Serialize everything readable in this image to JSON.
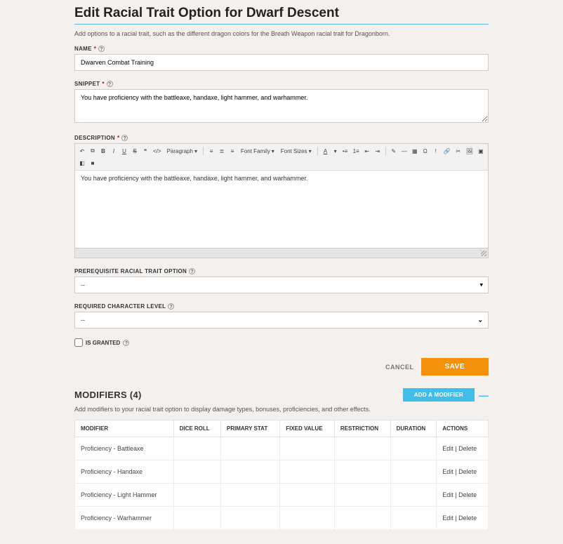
{
  "page": {
    "title": "Edit Racial Trait Option for Dwarf Descent",
    "subtitle": "Add options to a racial trait, such as the different dragon colors for the Breath Weapon racial trait for Dragonborn."
  },
  "fields": {
    "name": {
      "label": "NAME",
      "value": "Dwarven Combat Training"
    },
    "snippet": {
      "label": "SNIPPET",
      "value": "You have proficiency with the battleaxe, handaxe, light hammer, and warhammer."
    },
    "description": {
      "label": "DESCRIPTION",
      "value": "You have proficiency with the battleaxe, handaxe, light hammer, and warhammer.",
      "toolbar": {
        "paragraph": "Paragraph",
        "fontfamily": "Font Family",
        "fontsize": "Font Sizes"
      }
    },
    "prereq": {
      "label": "PREREQUISITE RACIAL TRAIT OPTION",
      "value": "--"
    },
    "reqlevel": {
      "label": "REQUIRED CHARACTER LEVEL",
      "value": "--"
    },
    "granted": {
      "label": "IS GRANTED"
    }
  },
  "actions": {
    "cancel": "CANCEL",
    "save": "SAVE"
  },
  "modifiers": {
    "title": "MODIFIERS (4)",
    "add_label": "ADD A MODIFIER",
    "desc": "Add modifiers to your racial trait option to display damage types, bonuses, proficiencies, and other effects.",
    "columns": {
      "modifier": "MODIFIER",
      "diceroll": "DICE ROLL",
      "primarystat": "PRIMARY STAT",
      "fixedvalue": "FIXED VALUE",
      "restriction": "RESTRICTION",
      "duration": "DURATION",
      "actions": "ACTIONS"
    },
    "row_actions": {
      "edit": "Edit",
      "delete": "Delete"
    },
    "rows": [
      {
        "modifier": "Proficiency - Battleaxe"
      },
      {
        "modifier": "Proficiency - Handaxe"
      },
      {
        "modifier": "Proficiency - Light Hammer"
      },
      {
        "modifier": "Proficiency - Warhammer"
      }
    ]
  }
}
